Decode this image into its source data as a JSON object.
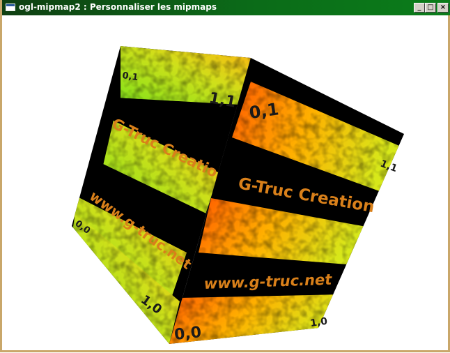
{
  "window": {
    "title": "ogl-mipmap2 : Personnaliser les mipmaps",
    "minimize_glyph": "_",
    "maximize_glyph": "□",
    "close_glyph": "×"
  },
  "cube": {
    "left_face": {
      "corner_top_left": "0,1",
      "corner_top_right": "1,1",
      "corner_bottom_left": "0,0",
      "corner_bottom_right": "1,0",
      "line1": "G-Truc Creation",
      "line2": "www.g-truc.net"
    },
    "right_face": {
      "corner_top_left": "0,1",
      "corner_top_right": "1,1",
      "corner_bottom_left": "0,0",
      "corner_bottom_right": "1,0",
      "line1": "G-Truc Creation",
      "line2": "www.g-truc.net"
    }
  },
  "colors": {
    "title_bar": "#0b6b18",
    "window_border": "#c9a76a",
    "texture_green": "#7fe21a",
    "texture_yellow": "#e7d60f",
    "texture_orange": "#ff6a00",
    "text_dark": "#1a1a1a",
    "text_orange": "#d9801a"
  }
}
